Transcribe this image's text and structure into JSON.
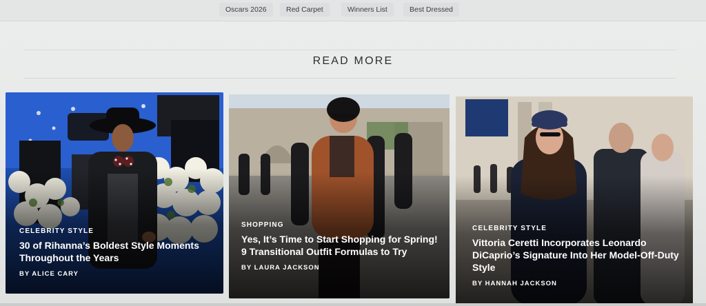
{
  "nav": {
    "tags": [
      {
        "label": "Oscars 2026"
      },
      {
        "label": "Red Carpet"
      },
      {
        "label": "Winners List"
      },
      {
        "label": "Best Dressed"
      }
    ]
  },
  "section": {
    "heading": "READ MORE"
  },
  "cards": [
    {
      "kicker": "CELEBRITY STYLE",
      "title": "30 of Rihanna’s Boldest Style Moments Throughout the Years",
      "byline": "BY ALICE CARY"
    },
    {
      "kicker": "SHOPPING",
      "title": "Yes, It’s Time to Start Shopping for Spring! 9 Transitional Outfit Formulas to Try",
      "byline": "BY LAURA JACKSON"
    },
    {
      "kicker": "CELEBRITY STYLE",
      "title": "Vittoria Ceretti Incorporates Leonardo DiCaprio’s Signature Into Her Model-Off-Duty Style",
      "byline": "BY HANNAH JACKSON"
    }
  ],
  "colors": {
    "background": "#e9ebea",
    "heading": "#2b2e31",
    "card_text": "#ffffff"
  }
}
